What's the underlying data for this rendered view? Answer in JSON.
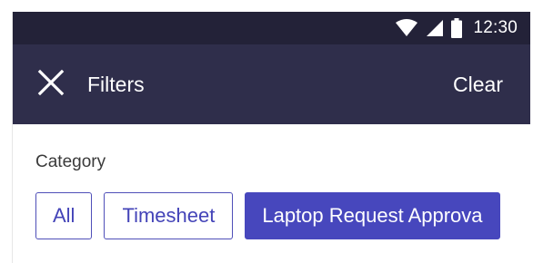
{
  "status_bar": {
    "time": "12:30",
    "icons": [
      "wifi-icon",
      "cell-signal-icon",
      "battery-icon"
    ]
  },
  "app_bar": {
    "close_icon": "close-icon",
    "title": "Filters",
    "clear_label": "Clear"
  },
  "filters": {
    "category_label": "Category",
    "chips": [
      {
        "label": "All",
        "selected": false
      },
      {
        "label": "Timesheet",
        "selected": false
      },
      {
        "label": "Laptop Request Approva",
        "selected": true
      }
    ]
  },
  "colors": {
    "status_bar_bg": "#232238",
    "app_bar_bg": "#2f2e4b",
    "accent": "#4747bd",
    "chip_border": "#4f4fb8",
    "text_dark": "#3a3a3a"
  }
}
